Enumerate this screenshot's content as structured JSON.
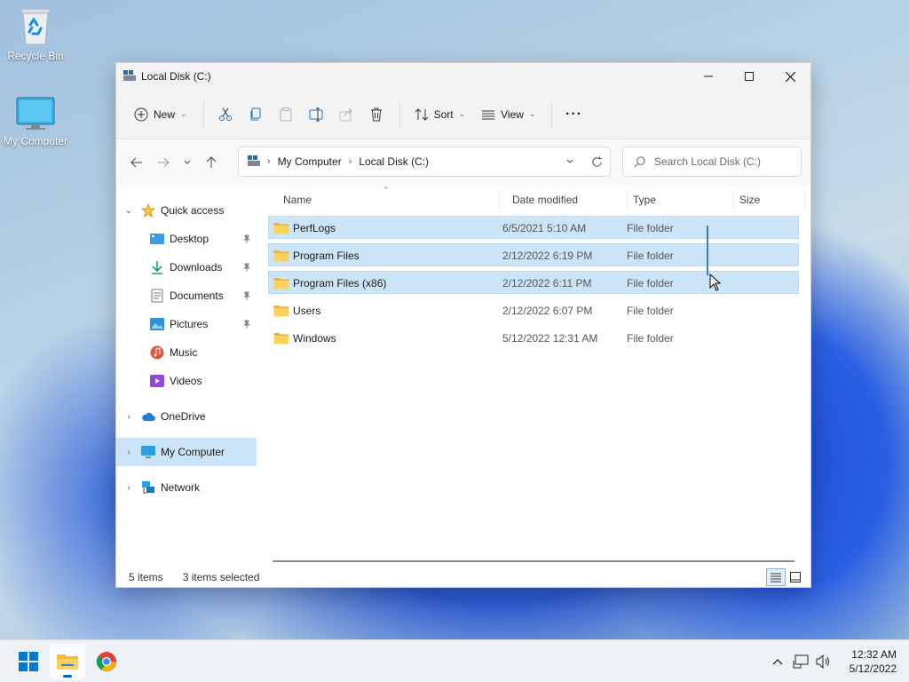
{
  "desktop": {
    "icons": [
      {
        "label": "Recycle Bin",
        "icon": "recycle-bin-icon"
      },
      {
        "label": "My Computer",
        "icon": "monitor-icon"
      }
    ]
  },
  "window": {
    "title": "Local Disk (C:)",
    "toolbar": {
      "new_label": "New",
      "sort_label": "Sort",
      "view_label": "View",
      "more_label": "···"
    },
    "address": {
      "crumbs": [
        "My Computer",
        "Local Disk (C:)"
      ]
    },
    "search": {
      "placeholder": "Search Local Disk (C:)"
    },
    "sidebar": {
      "quick_access": "Quick access",
      "quick_items": [
        {
          "label": "Desktop",
          "icon": "desktop-folder-icon",
          "pinned": true
        },
        {
          "label": "Downloads",
          "icon": "download-icon",
          "pinned": true
        },
        {
          "label": "Documents",
          "icon": "documents-icon",
          "pinned": true
        },
        {
          "label": "Pictures",
          "icon": "pictures-icon",
          "pinned": true
        },
        {
          "label": "Music",
          "icon": "music-icon",
          "pinned": false
        },
        {
          "label": "Videos",
          "icon": "videos-icon",
          "pinned": false
        }
      ],
      "onedrive": "OneDrive",
      "my_computer": "My Computer",
      "network": "Network"
    },
    "columns": {
      "name": "Name",
      "date": "Date modified",
      "type": "Type",
      "size": "Size"
    },
    "files": [
      {
        "name": "PerfLogs",
        "date": "6/5/2021 5:10 AM",
        "type": "File folder",
        "size": "",
        "selected": true
      },
      {
        "name": "Program Files",
        "date": "2/12/2022 6:19 PM",
        "type": "File folder",
        "size": "",
        "selected": true
      },
      {
        "name": "Program Files (x86)",
        "date": "2/12/2022 6:11 PM",
        "type": "File folder",
        "size": "",
        "selected": true
      },
      {
        "name": "Users",
        "date": "2/12/2022 6:07 PM",
        "type": "File folder",
        "size": "",
        "selected": false
      },
      {
        "name": "Windows",
        "date": "5/12/2022 12:31 AM",
        "type": "File folder",
        "size": "",
        "selected": false
      }
    ],
    "status": {
      "items": "5 items",
      "selected": "3 items selected"
    }
  },
  "taskbar": {
    "time": "12:32 AM",
    "date": "5/12/2022"
  },
  "colors": {
    "accent": "#0067c0",
    "selection": "#cce4f7",
    "folder": "#f8c94a"
  }
}
